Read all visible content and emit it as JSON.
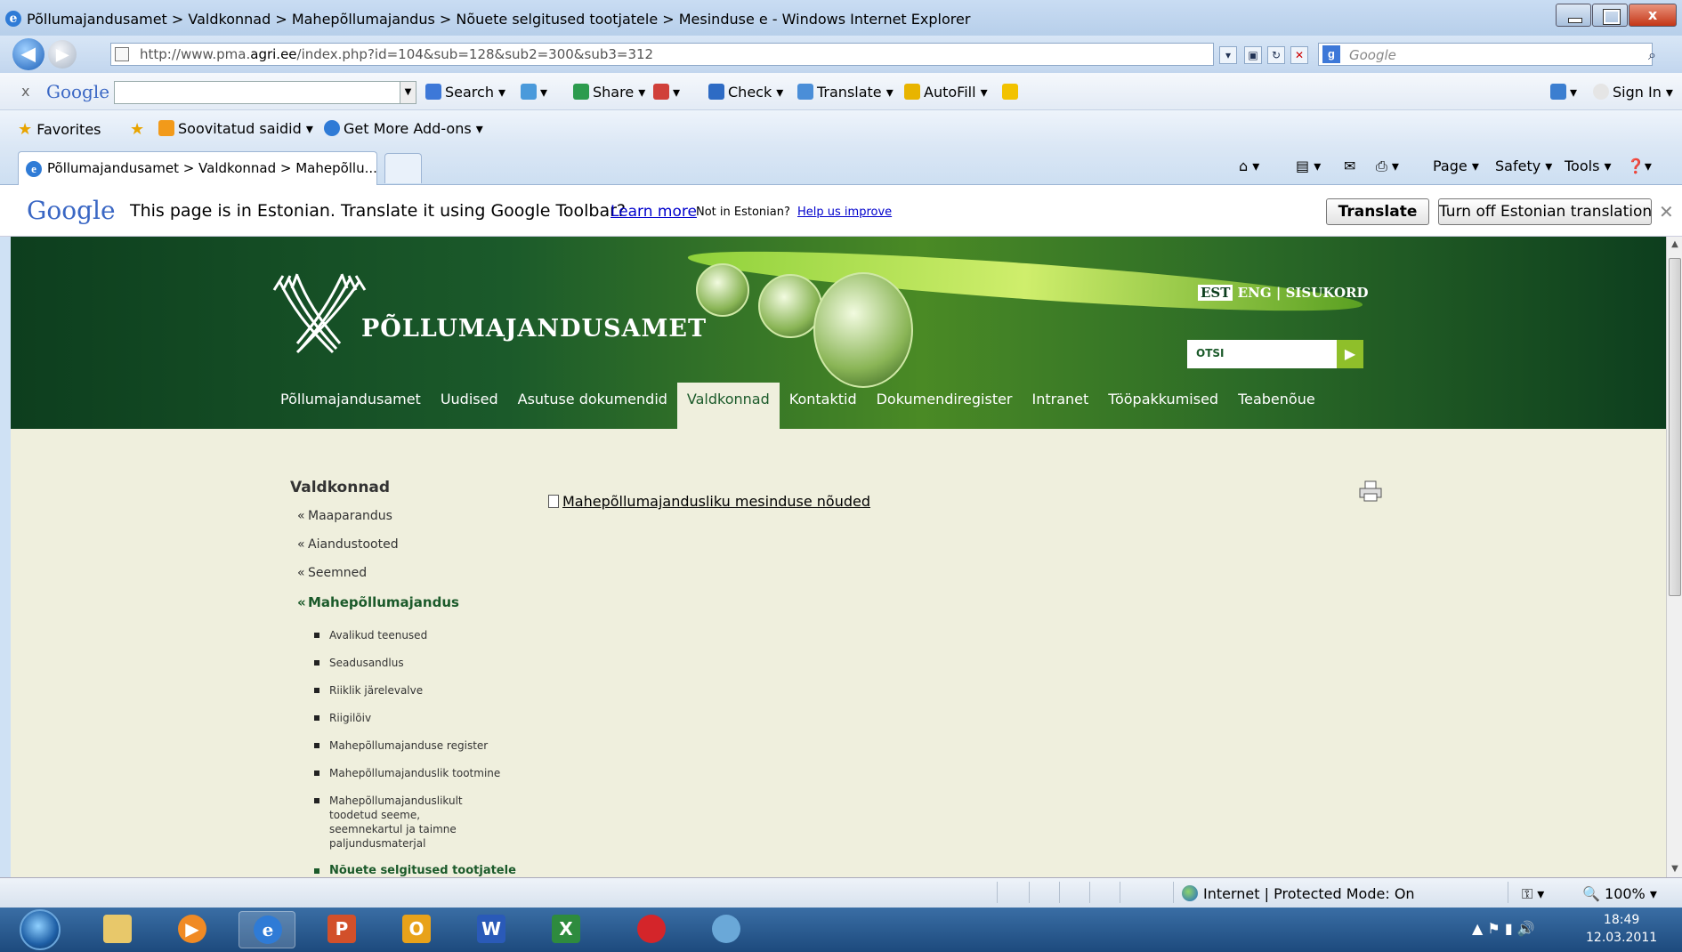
{
  "window": {
    "title": "Põllumajandusamet > Valdkonnad > Mahepõllumajandus > Nõuete selgitused tootjatele > Mesinduse e - Windows Internet Explorer",
    "close_glyph": "x"
  },
  "address": {
    "url_prefix": "http://www.pma.",
    "url_domain": "agri.ee",
    "url_suffix": "/index.php?id=104&sub=128&sub2=300&sub3=312",
    "search_placeholder": "Google"
  },
  "google_toolbar": {
    "logo": "Google",
    "close_glyph": "x",
    "items": [
      "Search",
      "Share",
      "Check",
      "Translate",
      "AutoFill"
    ],
    "sign_in": "Sign In"
  },
  "favorites": {
    "label": "Favorites",
    "items": [
      "Soovitatud saidid",
      "Get More Add-ons"
    ]
  },
  "tabs": {
    "active_tab": "Põllumajandusamet > Valdkonnad > Mahepõllu...",
    "commands": [
      "Page",
      "Safety",
      "Tools"
    ]
  },
  "translate_bar": {
    "logo": "Google",
    "message": "This page is in Estonian.  Translate it using Google Toolbar?",
    "learn_more": "Learn more",
    "not_in": "Not in Estonian?",
    "help": "Help us improve",
    "translate_button": "Translate",
    "turn_off_button": "Turn off Estonian translation",
    "close_glyph": "✕"
  },
  "site": {
    "logo_text": "PÕLLUMAJANDUSAMET",
    "lang_est": "EST",
    "lang_eng": "ENG",
    "separator": "|",
    "sitemap": "SISUKORD",
    "search_label": "OTSI",
    "nav": [
      "Põllumajandusamet",
      "Uudised",
      "Asutuse dokumendid",
      "Valdkonnad",
      "Kontaktid",
      "Dokumendiregister",
      "Intranet",
      "Tööpakkumised",
      "Teabenõue"
    ],
    "active_nav": "Valdkonnad"
  },
  "sidebar": {
    "heading": "Valdkonnad",
    "level1": [
      "Maaparandus",
      "Aiandustooted",
      "Seemned",
      "Mahepõllumajandus"
    ],
    "level2": [
      "Avalikud teenused",
      "Seadusandlus",
      "Riiklik järelevalve",
      "Riigilõiv",
      "Mahepõllumajanduse register",
      "Mahepõllumajanduslik tootmine",
      "Mahepõllumajanduslikult toodetud seeme, seemnekartul ja taimne paljundusmaterjal",
      "Nõuete selgitused tootjatele"
    ]
  },
  "content": {
    "document_link": "Mahepõllumajandusliku mesinduse nõuded"
  },
  "status": {
    "zone": "Internet | Protected Mode: On",
    "zoom": "100%"
  },
  "taskbar": {
    "time": "18:49",
    "date": "12.03.2011"
  }
}
